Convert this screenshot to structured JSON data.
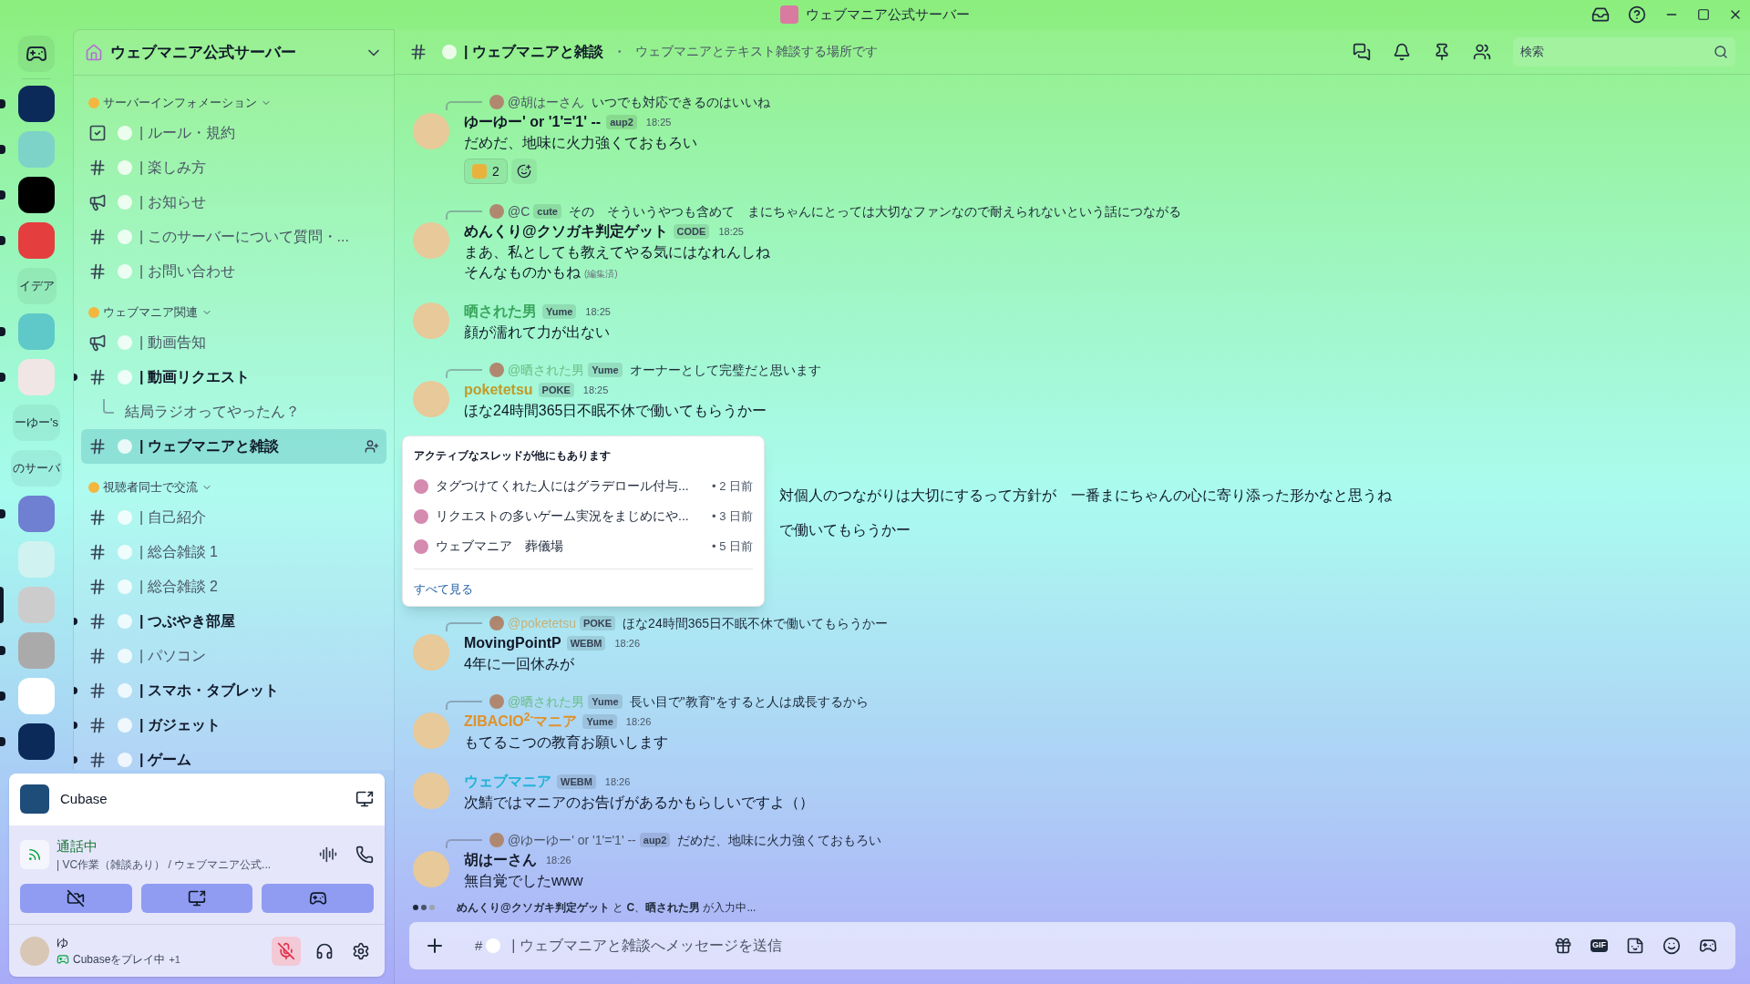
{
  "window": {
    "title": "ウェブマニア公式サーバー"
  },
  "servers": [
    {
      "kind": "home",
      "unread": false,
      "selected": false
    },
    {
      "kind": "image",
      "unread": true,
      "selected": false
    },
    {
      "kind": "image",
      "unread": true,
      "selected": false
    },
    {
      "kind": "image",
      "unread": true,
      "selected": false
    },
    {
      "kind": "image",
      "unread": true,
      "selected": false
    },
    {
      "kind": "text",
      "label": "イデア",
      "unread": false,
      "selected": false
    },
    {
      "kind": "image",
      "unread": true,
      "selected": false
    },
    {
      "kind": "image",
      "unread": true,
      "selected": false
    },
    {
      "kind": "text",
      "label": "ーゆー's",
      "unread": false,
      "selected": false
    },
    {
      "kind": "text",
      "label": "のサーバ",
      "unread": false,
      "selected": false
    },
    {
      "kind": "image",
      "unread": true,
      "selected": false
    },
    {
      "kind": "image",
      "unread": false,
      "selected": false
    },
    {
      "kind": "image",
      "unread": false,
      "selected": true
    },
    {
      "kind": "image",
      "unread": true,
      "selected": false
    },
    {
      "kind": "image",
      "unread": true,
      "selected": false
    },
    {
      "kind": "image",
      "unread": true,
      "selected": false
    }
  ],
  "sidebar": {
    "server_name": "ウェブマニア公式サーバー",
    "categories": [
      {
        "name": "サーバーインフォメーション",
        "channels": [
          {
            "kind": "rules",
            "name": "| ルール・規約",
            "unread": false,
            "selected": false
          },
          {
            "kind": "text",
            "name": "| 楽しみ方",
            "unread": false,
            "selected": false
          },
          {
            "kind": "announce",
            "name": "| お知らせ",
            "unread": false,
            "selected": false
          },
          {
            "kind": "text",
            "name": "| このサーバーについて質問・...",
            "unread": false,
            "selected": false
          },
          {
            "kind": "text",
            "name": "| お問い合わせ",
            "unread": false,
            "selected": false
          }
        ]
      },
      {
        "name": "ウェブマニア関連",
        "channels": [
          {
            "kind": "announce",
            "name": "| 動画告知",
            "unread": false,
            "selected": false
          },
          {
            "kind": "text",
            "name": "| 動画リクエスト",
            "unread": true,
            "selected": false,
            "threads": [
              "結局ラジオってやったん？"
            ]
          },
          {
            "kind": "text",
            "name": "| ウェブマニアと雑談",
            "unread": false,
            "selected": true
          }
        ]
      },
      {
        "name": "視聴者同士で交流",
        "channels": [
          {
            "kind": "text",
            "name": "| 自己紹介",
            "unread": false,
            "selected": false
          },
          {
            "kind": "text",
            "name": "| 総合雑談 1",
            "unread": false,
            "selected": false
          },
          {
            "kind": "text",
            "name": "| 総合雑談 2",
            "unread": false,
            "selected": false
          },
          {
            "kind": "text",
            "name": "| つぶやき部屋",
            "unread": true,
            "selected": false
          },
          {
            "kind": "text",
            "name": "| パソコン",
            "unread": false,
            "selected": false
          },
          {
            "kind": "text",
            "name": "| スマホ・タブレット",
            "unread": true,
            "selected": false
          },
          {
            "kind": "text",
            "name": "| ガジェット",
            "unread": true,
            "selected": false
          },
          {
            "kind": "text",
            "name": "| ゲーム",
            "unread": true,
            "selected": false
          }
        ]
      }
    ]
  },
  "activity": {
    "name": "Cubase"
  },
  "voice": {
    "status": "通話中",
    "channel": "| VC作業（雑談あり） / ウェブマニア公式..."
  },
  "user": {
    "name": "ゆ",
    "status": "Cubaseをプレイ中",
    "extra": "+1",
    "muted": true
  },
  "chat_header": {
    "channel": "| ウェブマニアと雑談",
    "separator": "•",
    "topic": "ウェブマニアとテキスト雑談する場所です",
    "search_placeholder": "検索"
  },
  "messages": [
    {
      "kind": "message",
      "reply": {
        "author": "@胡はーさん",
        "color": "#4b5563",
        "text": "いつでも対応できるのはいいね"
      },
      "author": "ゆーゆー' or '1'='1' --",
      "color": "#111827",
      "tag": "aup2",
      "time": "18:25",
      "lines": [
        "だめだ、地味に火力強くておもろい"
      ],
      "reactions": [
        {
          "count": "2"
        }
      ]
    },
    {
      "kind": "message",
      "reply": {
        "author": "@C",
        "color": "#4b5563",
        "tag": "cute",
        "text": "その　そういうやつも含めて　まにちゃんにとっては大切なファンなので耐えられないという話につながる"
      },
      "author": "めんくり@クソガキ判定ゲット",
      "color": "#111827",
      "tag": "CODE",
      "time": "18:25",
      "lines": [
        "まあ、私としても教えてやる気にはなれんしね",
        "そんなものかもね"
      ],
      "edited": "(編集済)"
    },
    {
      "kind": "message",
      "author": "晒された男",
      "color": "#3aa55d",
      "tag": "Yume",
      "time": "18:25",
      "lines": [
        "顔が濡れて力が出ない"
      ]
    },
    {
      "kind": "message",
      "reply": {
        "author": "@晒された男",
        "color": "#6bbf85",
        "tag": "Yume",
        "text": "オーナーとして完璧だと思います"
      },
      "author": "poketetsu",
      "color": "#c29a2a",
      "tag": "POKE",
      "time": "18:25",
      "lines": [
        "ほな24時間365日不眠不休で働いてもらうかー"
      ]
    },
    {
      "kind": "fragment",
      "text": "対個人のつながりは大切にするって方針が　一番まにちゃんの心に寄り添った形かなと思うね"
    },
    {
      "kind": "fragment",
      "text": "で働いてもらうかー"
    },
    {
      "kind": "message",
      "reply": {
        "author": "@poketetsu",
        "color": "#c7b27a",
        "tag": "POKE",
        "text": "ほな24時間365日不眠不休で働いてもらうかー"
      },
      "author": "MovingPointP",
      "color": "#111827",
      "tag": "WEBM",
      "time": "18:26",
      "lines": [
        "4年に一回休みが"
      ]
    },
    {
      "kind": "message",
      "reply": {
        "author": "@晒された男",
        "color": "#6bbf85",
        "tag": "Yume",
        "text": "長い目で\"教育\"をすると人は成長するから"
      },
      "author": "ZIBACIO$^{2-}$マニア",
      "color": "#e0922a",
      "tag": "Yume",
      "time": "18:26",
      "lines": [
        "もてるこつの教育お願いします"
      ]
    },
    {
      "kind": "message",
      "author": "ウェブマニア",
      "color": "#22b3d6",
      "tag": "WEBM",
      "time": "18:26",
      "lines": [
        "次鯖ではマニアのお告げがあるかもらしいですよ（）"
      ]
    },
    {
      "kind": "message",
      "reply": {
        "author": "@ゆーゆー' or '1'='1' --",
        "color": "#4b5563",
        "tag": "aup2",
        "text": "だめだ、地味に火力強くておもろい"
      },
      "author": "胡はーさん",
      "color": "#111827",
      "time": "18:26",
      "lines": [
        "無自覚でしたwww"
      ]
    }
  ],
  "typing": "**めんくり@クソガキ判定ゲット** と **C**、**晒された男** が入力中...",
  "thread_popup": {
    "title": "アクティブなスレッドが他にもあります",
    "threads": [
      {
        "name": "タグつけてくれた人にはグラデロール付与...",
        "age": "• 2 日前"
      },
      {
        "name": "リクエストの多いゲーム実況をまじめにや...",
        "age": "• 3 日前"
      },
      {
        "name": "ウェブマニア　葬儀場",
        "age": "• 5 日前"
      }
    ],
    "link": "すべて見る"
  },
  "composer": {
    "prefix": "#",
    "placeholder": "| ウェブマニアと雑談へメッセージを送信",
    "gif_label": "GIF"
  }
}
